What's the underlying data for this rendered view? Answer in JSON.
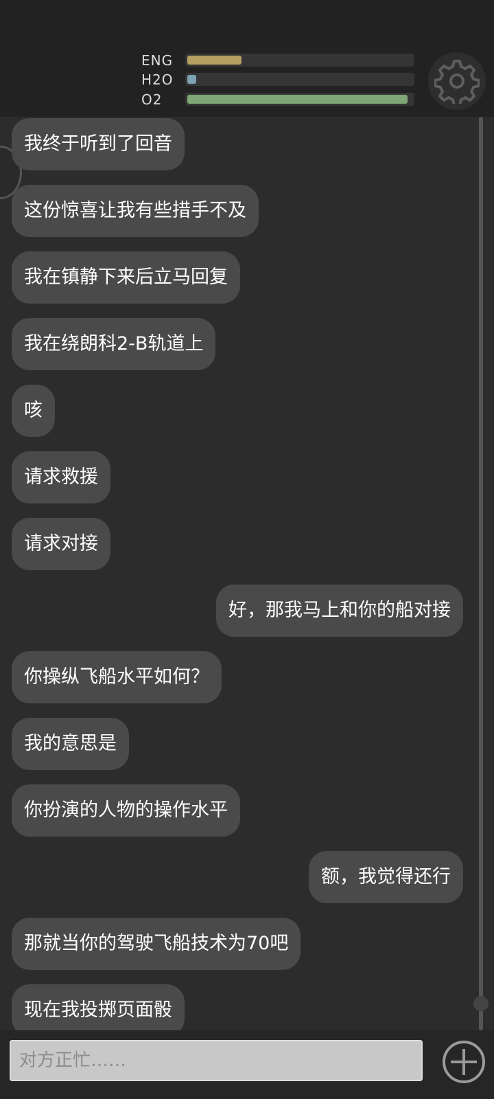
{
  "stats": [
    {
      "label": "ENG",
      "value": 0.24,
      "color": "#b59f62"
    },
    {
      "label": "H2O",
      "value": 0.04,
      "color": "#7ea3b5"
    },
    {
      "label": "O2",
      "value": 0.98,
      "color": "#7fa676"
    }
  ],
  "messages": [
    {
      "side": "left",
      "text": "我终于听到了回音"
    },
    {
      "side": "left",
      "text": "这份惊喜让我有些措手不及"
    },
    {
      "side": "left",
      "text": "我在镇静下来后立马回复"
    },
    {
      "side": "left",
      "text": "我在绕朗科2-B轨道上"
    },
    {
      "side": "left",
      "text": "咳"
    },
    {
      "side": "left",
      "text": "请求救援"
    },
    {
      "side": "left",
      "text": "请求对接"
    },
    {
      "side": "right",
      "text": "好，那我马上和你的船对接"
    },
    {
      "side": "left",
      "text": "你操纵飞船水平如何？"
    },
    {
      "side": "left",
      "text": "我的意思是"
    },
    {
      "side": "left",
      "text": "你扮演的人物的操作水平"
    },
    {
      "side": "right",
      "text": "额，我觉得还行"
    },
    {
      "side": "left",
      "text": "那就当你的驾驶飞船技术为70吧"
    },
    {
      "side": "left",
      "text": "现在我投掷页面骰"
    }
  ],
  "input": {
    "placeholder": "对方正忙……"
  }
}
